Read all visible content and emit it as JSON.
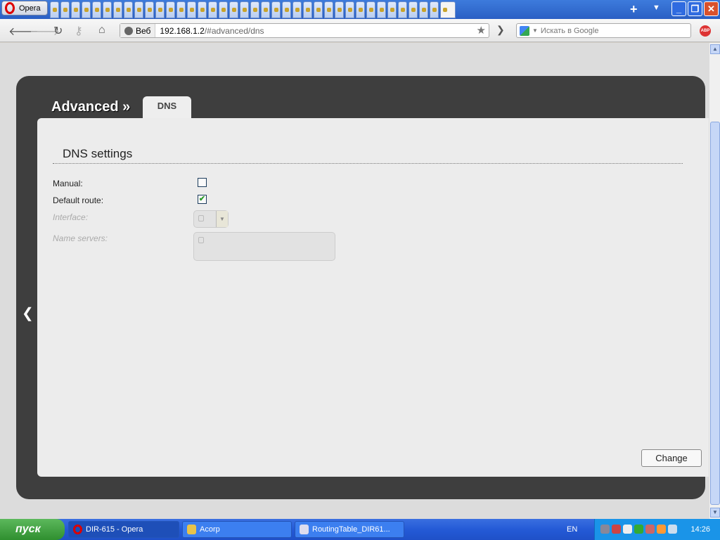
{
  "browser": {
    "opera_label": "Opera",
    "address_prefix": "Веб",
    "url_host": "192.168.1.2",
    "url_path": "/#advanced/dns",
    "search_placeholder": "Искать в Google",
    "abp": "ABP",
    "tab_count": 38
  },
  "page": {
    "breadcrumb": "Advanced »",
    "tab": "DNS",
    "section_title": "DNS settings",
    "fields": {
      "manual": {
        "label": "Manual:",
        "checked": false
      },
      "default_route": {
        "label": "Default route:",
        "checked": true
      },
      "interface": {
        "label": "Interface:"
      },
      "name_servers": {
        "label": "Name servers:"
      }
    },
    "change_label": "Change"
  },
  "taskbar": {
    "start": "пуск",
    "tasks": [
      "DIR-615 - Opera",
      "Acorp",
      "RoutingTable_DIR61..."
    ],
    "lang": "EN",
    "clock": "14:26"
  }
}
